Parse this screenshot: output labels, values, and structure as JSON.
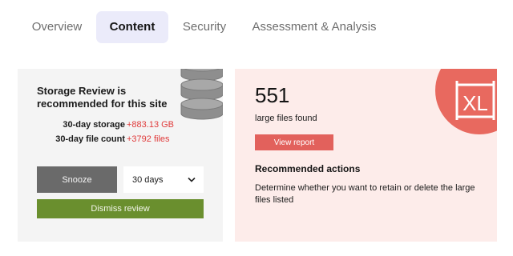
{
  "tabs": [
    {
      "label": "Overview",
      "active": false
    },
    {
      "label": "Content",
      "active": true
    },
    {
      "label": "Security",
      "active": false
    },
    {
      "label": "Assessment & Analysis",
      "active": false
    }
  ],
  "storage_review": {
    "title": "Storage Review is recommended for this site",
    "stats": [
      {
        "label": "30-day storage",
        "value": "+883.13 GB"
      },
      {
        "label": "30-day file count",
        "value": "+3792 files"
      }
    ],
    "snooze_label": "Snooze",
    "snooze_duration": "30 days",
    "dismiss_label": "Dismiss review"
  },
  "large_files": {
    "count": "551",
    "count_label": "large files found",
    "view_report_label": "View report",
    "badge_text": "XL",
    "recommended_heading": "Recommended actions",
    "recommended_text": "Determine whether you want to retain or delete the large files listed"
  },
  "colors": {
    "accent_tab_bg": "#ebebfa",
    "stat_value": "#e03b3b",
    "snooze_bg": "#6a6a6a",
    "dismiss_bg": "#6a8f2e",
    "view_report_bg": "#e2615c",
    "right_card_bg": "#fdecea",
    "left_card_bg": "#f4f4f4"
  },
  "icons": {
    "disk_stack": "database-icon",
    "badge": "xl-file-icon",
    "dropdown": "chevron-down-icon"
  }
}
